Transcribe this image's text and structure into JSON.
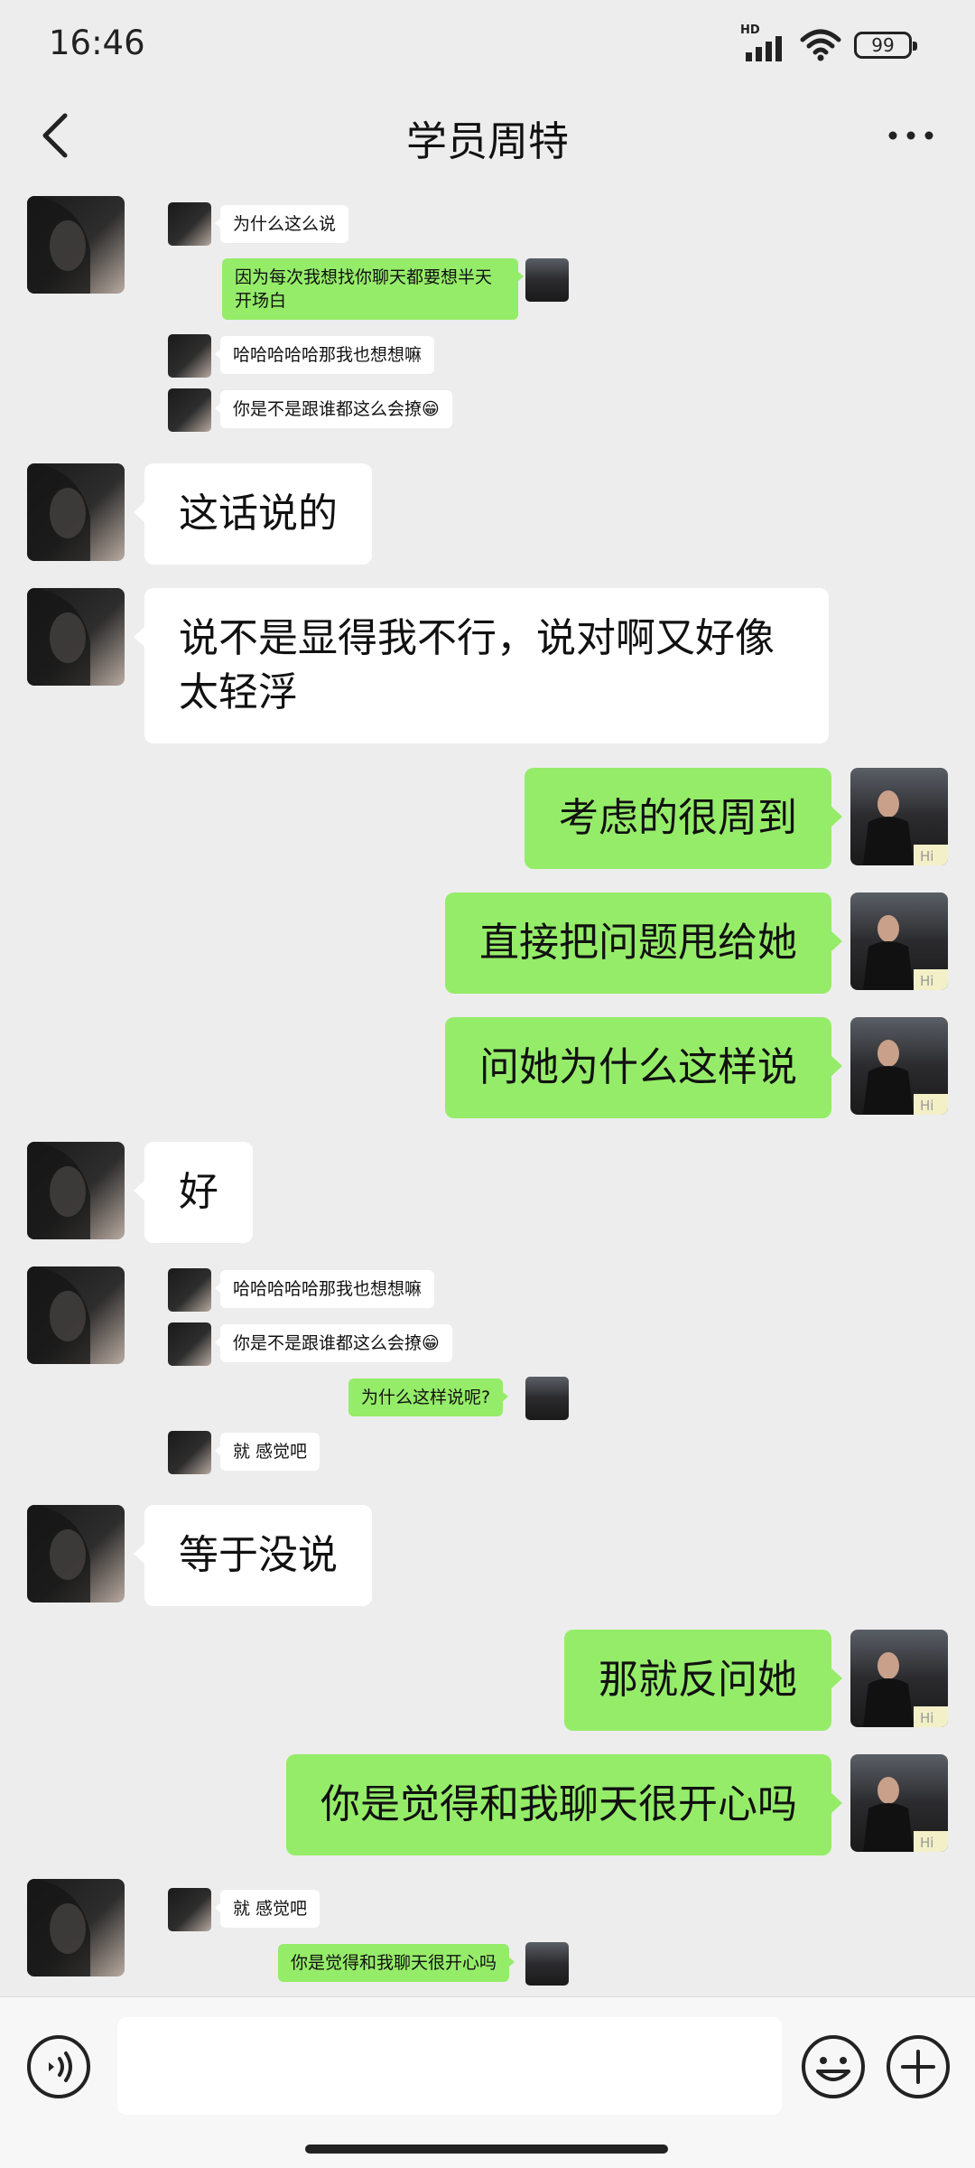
{
  "status_bar": {
    "time": "16:46",
    "hd_label": "HD",
    "battery": "99"
  },
  "nav": {
    "title": "学员周特",
    "back_icon": "chevron-left-icon",
    "more_icon": "more-dots-icon"
  },
  "messages": [
    {
      "type": "screenshot",
      "items": [
        {
          "side": "left",
          "text": "为什么这么说"
        },
        {
          "side": "right",
          "text": "因为每次我想找你聊天都要想半天开场白"
        },
        {
          "side": "left",
          "text": "哈哈哈哈哈那我也想想嘛"
        },
        {
          "side": "left",
          "text": "你是不是跟谁都这么会撩😁"
        }
      ]
    },
    {
      "side": "left",
      "text": "这话说的"
    },
    {
      "side": "left",
      "text": "说不是显得我不行，说对啊又好像太轻浮"
    },
    {
      "side": "right",
      "text": "考虑的很周到"
    },
    {
      "side": "right",
      "text": "直接把问题甩给她"
    },
    {
      "side": "right",
      "text": "问她为什么这样说"
    },
    {
      "side": "left",
      "text": "好"
    },
    {
      "type": "screenshot",
      "items": [
        {
          "side": "left",
          "text": "哈哈哈哈哈那我也想想嘛"
        },
        {
          "side": "left",
          "text": "你是不是跟谁都这么会撩😁"
        },
        {
          "side": "right",
          "text": "为什么这样说呢?"
        },
        {
          "side": "left",
          "text": "就 感觉吧"
        }
      ]
    },
    {
      "side": "left",
      "text": "等于没说"
    },
    {
      "side": "right",
      "text": "那就反问她"
    },
    {
      "side": "right",
      "text": "你是觉得和我聊天很开心吗"
    },
    {
      "type": "screenshot",
      "items": [
        {
          "side": "left",
          "text": "就 感觉吧"
        },
        {
          "side": "right",
          "text": "你是觉得和我聊天很开心吗"
        }
      ]
    }
  ],
  "input_bar": {
    "voice_icon": "voice-icon",
    "input_value": "",
    "emoji_icon": "emoji-icon",
    "plus_icon": "plus-icon"
  },
  "colors": {
    "background": "#ededed",
    "sent_bubble": "#95ec69",
    "received_bubble": "#ffffff"
  }
}
